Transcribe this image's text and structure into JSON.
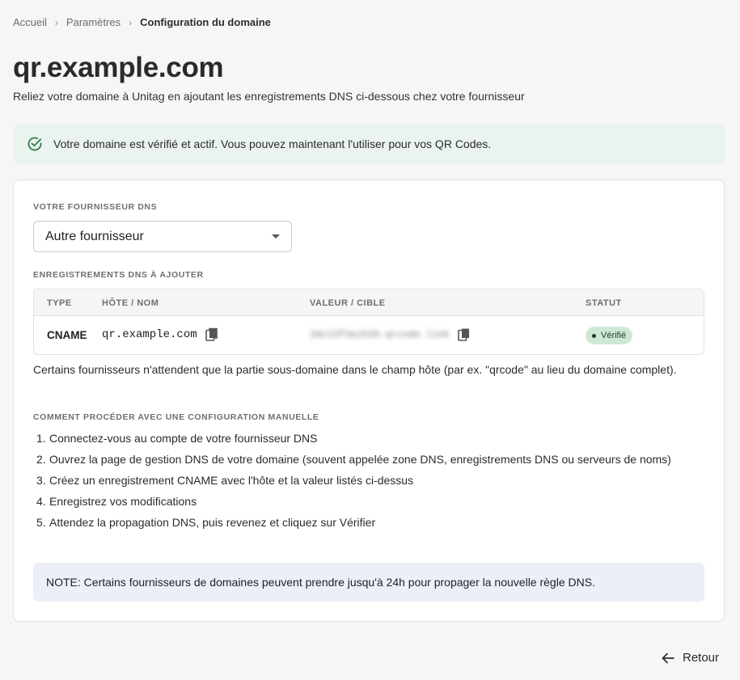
{
  "breadcrumb": {
    "items": [
      "Accueil",
      "Paramètres"
    ],
    "current": "Configuration du domaine"
  },
  "page": {
    "title": "qr.example.com",
    "subtitle": "Reliez votre domaine à Unitag en ajoutant les enregistrements DNS ci-dessous chez votre fournisseur"
  },
  "alert": {
    "text": "Votre domaine est vérifié et actif. Vous pouvez maintenant l'utiliser pour vos QR Codes.",
    "icon": "check-circle-icon",
    "color": "#2e7d4a"
  },
  "provider": {
    "label": "VOTRE FOURNISSEUR DNS",
    "selected": "Autre fournisseur"
  },
  "dns": {
    "label": "ENREGISTREMENTS DNS À AJOUTER",
    "headers": {
      "type": "TYPE",
      "host": "HÔTE / NOM",
      "value": "VALEUR / CIBLE",
      "status": "STATUT"
    },
    "row": {
      "type": "CNAME",
      "host": "qr.example.com",
      "value": "3dc23f3a1539.qrcode.link",
      "status": "Vérifié"
    },
    "host_note": "Certains fournisseurs n'attendent que la partie sous-domaine dans le champ hôte (par ex. \"qrcode\" au lieu du domaine complet)."
  },
  "manual": {
    "label": "COMMENT PROCÉDER AVEC UNE CONFIGURATION MANUELLE",
    "steps": [
      {
        "num": "1.",
        "text": "Connectez-vous au compte de votre fournisseur DNS"
      },
      {
        "num": "2.",
        "text": "Ouvrez la page de gestion DNS de votre domaine (souvent appelée zone DNS, enregistrements DNS ou serveurs de noms)"
      },
      {
        "num": "3.",
        "text": "Créez un enregistrement CNAME avec l'hôte et la valeur listés ci-dessus"
      },
      {
        "num": "4.",
        "text": "Enregistrez vos modifications"
      },
      {
        "num": "5.",
        "text": "Attendez la propagation DNS, puis revenez et cliquez sur Vérifier"
      }
    ],
    "note": "NOTE: Certains fournisseurs de domaines peuvent prendre jusqu'à 24h pour propager la nouvelle règle DNS."
  },
  "footer": {
    "back_label": "Retour"
  }
}
